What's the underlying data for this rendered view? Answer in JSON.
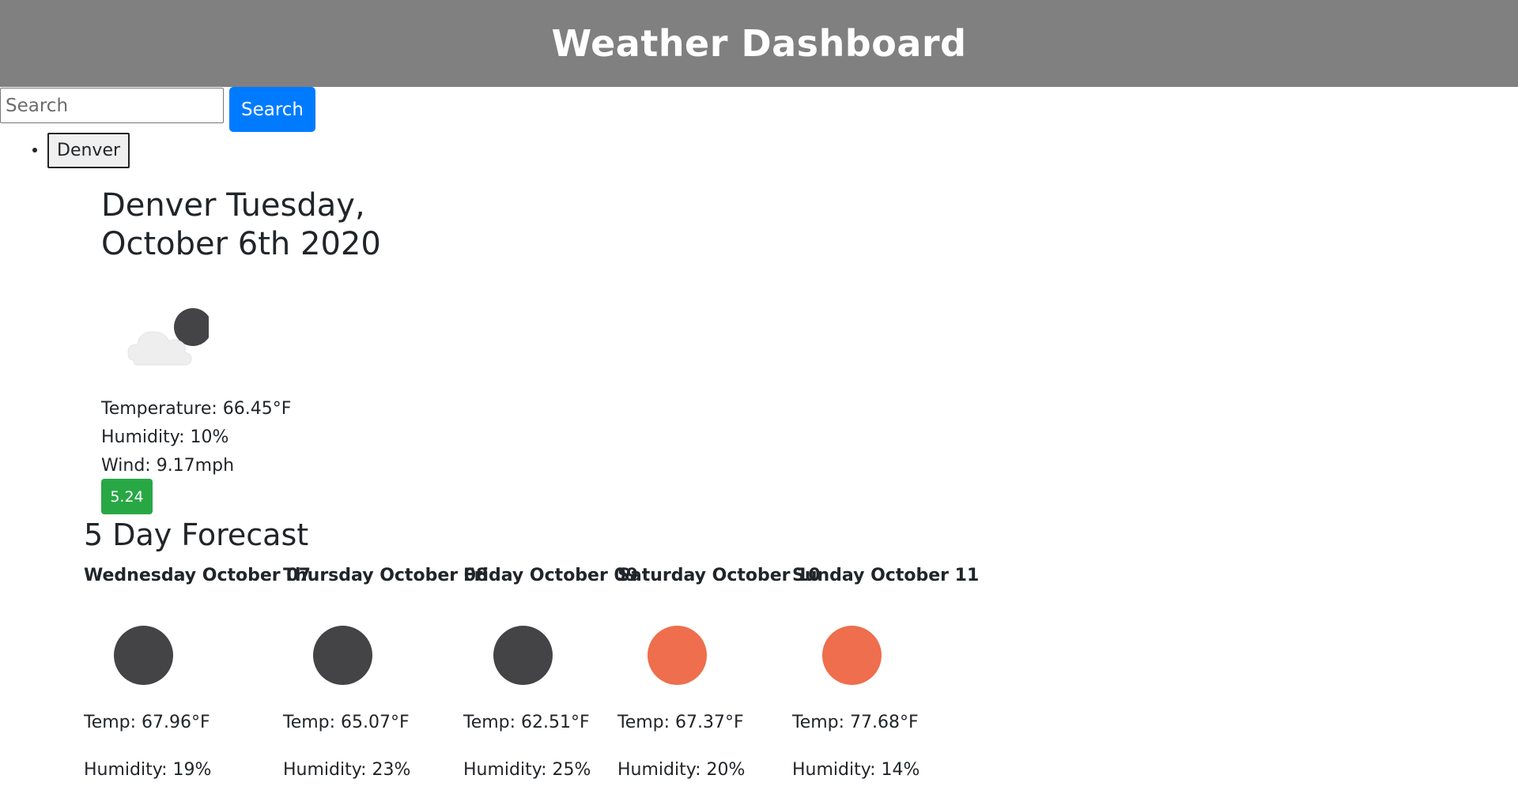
{
  "header": {
    "title": "Weather Dashboard"
  },
  "search": {
    "placeholder": "Search",
    "button_label": "Search"
  },
  "history": [
    "Denver"
  ],
  "current": {
    "heading": "Denver Tuesday, October 6th 2020",
    "icon": "cloud-moon-icon",
    "temperature": "Temperature: 66.45°F",
    "humidity": "Humidity: 10%",
    "wind": "Wind: 9.17mph",
    "uv_index": "5.24",
    "uv_color": "#28a745"
  },
  "forecast": {
    "title": "5 Day Forecast",
    "days": [
      {
        "date": "Wednesday October 07",
        "icon": "moon-icon",
        "icon_color": "#444446",
        "temp": "Temp: 67.96°F",
        "humidity": "Humidity: 19%"
      },
      {
        "date": "Thursday October 08",
        "icon": "moon-icon",
        "icon_color": "#444446",
        "temp": "Temp: 65.07°F",
        "humidity": "Humidity: 23%"
      },
      {
        "date": "Friday October 09",
        "icon": "moon-icon",
        "icon_color": "#444446",
        "temp": "Temp: 62.51°F",
        "humidity": "Humidity: 25%"
      },
      {
        "date": "Saturday October 10",
        "icon": "sun-icon",
        "icon_color": "#ee6e4d",
        "temp": "Temp: 67.37°F",
        "humidity": "Humidity: 20%"
      },
      {
        "date": "Sunday October 11",
        "icon": "sun-icon",
        "icon_color": "#ee6e4d",
        "temp": "Temp: 77.68°F",
        "humidity": "Humidity: 14%"
      }
    ]
  }
}
